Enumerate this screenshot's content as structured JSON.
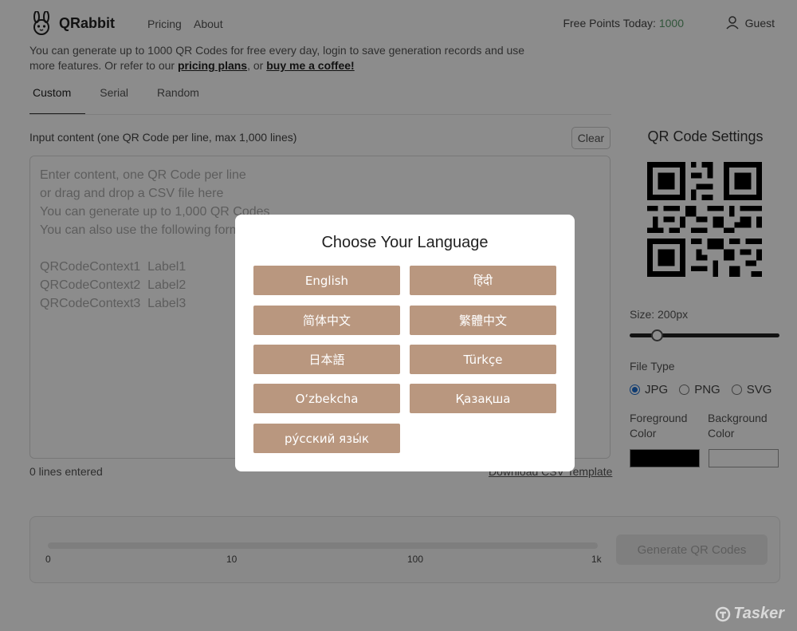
{
  "header": {
    "brand": "QRabbit",
    "nav": [
      "Pricing",
      "About"
    ],
    "points_label": "Free Points Today:",
    "points_value": "1000",
    "user": "Guest"
  },
  "intro": {
    "text_a": "You can generate up to 1000 QR Codes for free every day, login to save generation records and use more features. Or refer to our ",
    "link_pricing": "pricing plans",
    "text_b": ", or ",
    "link_coffee": "buy me a coffee!"
  },
  "tabs": [
    "Custom",
    "Serial",
    "Random"
  ],
  "input": {
    "label": "Input content (one QR Code per line, max 1,000 lines)",
    "clear": "Clear",
    "placeholder": "Enter content, one QR Code per line\nor drag and drop a CSV file here\nYou can generate up to 1,000 QR Codes\nYou can also use the following format\n\nQRCodeContext1  Label1\nQRCodeContext2  Label2\nQRCodeContext3  Label3",
    "lines_count": "0 lines entered",
    "csv_template": "Download CSV Template"
  },
  "settings": {
    "title": "QR Code Settings",
    "size_label": "Size: 200px",
    "size_fraction": 0.18,
    "file_type_label": "File Type",
    "file_types": [
      "JPG",
      "PNG",
      "SVG"
    ],
    "selected_file_type": "JPG",
    "fg_label": "Foreground Color",
    "bg_label": "Background Color",
    "fg_color": "#000000",
    "bg_color": "#ffffff"
  },
  "progress": {
    "ticks": [
      "0",
      "10",
      "100",
      "1k"
    ],
    "generate": "Generate QR Codes"
  },
  "modal": {
    "title": "Choose Your Language",
    "languages": [
      "English",
      "हिंदी",
      "简体中文",
      "繁體中文",
      "日本語",
      "Türkçe",
      "O‘zbekcha",
      "Қазақша",
      "рýсский язы́к"
    ]
  },
  "watermark": "Tasker",
  "colors": {
    "accent": "#b9977f",
    "points": "#5a9b6a",
    "radio": "#1c6dd0"
  }
}
